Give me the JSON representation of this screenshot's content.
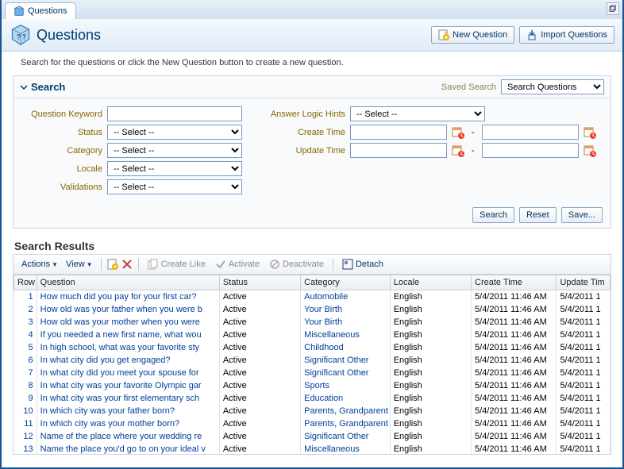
{
  "tab": {
    "label": "Questions"
  },
  "header": {
    "title": "Questions",
    "new_question": "New Question",
    "import_questions": "Import Questions"
  },
  "instruction": "Search for the questions or click the New Question button to create a new question.",
  "search": {
    "title": "Search",
    "saved_label": "Saved Search",
    "saved_value": "Search Questions",
    "fields": {
      "keyword": "Question Keyword",
      "status": "Status",
      "category": "Category",
      "locale": "Locale",
      "validations": "Validations",
      "answer_logic": "Answer Logic Hints",
      "create_time": "Create Time",
      "update_time": "Update Time"
    },
    "select_placeholder": "-- Select --",
    "buttons": {
      "search": "Search",
      "reset": "Reset",
      "save": "Save..."
    }
  },
  "results": {
    "title": "Search Results",
    "toolbar": {
      "actions": "Actions",
      "view": "View",
      "create_like": "Create Like",
      "activate": "Activate",
      "deactivate": "Deactivate",
      "detach": "Detach"
    },
    "columns": [
      "Row",
      "Question",
      "Status",
      "Category",
      "Locale",
      "Create Time",
      "Update Tim"
    ],
    "rows": [
      {
        "n": 1,
        "q": "How much did you pay for your first car?",
        "s": "Active",
        "c": "Automobile",
        "l": "English",
        "ct": "5/4/2011 11:46 AM",
        "ut": "5/4/2011 1"
      },
      {
        "n": 2,
        "q": "How old was your father when you were b",
        "s": "Active",
        "c": "Your Birth",
        "l": "English",
        "ct": "5/4/2011 11:46 AM",
        "ut": "5/4/2011 1"
      },
      {
        "n": 3,
        "q": "How old was your mother when you were",
        "s": "Active",
        "c": "Your Birth",
        "l": "English",
        "ct": "5/4/2011 11:46 AM",
        "ut": "5/4/2011 1"
      },
      {
        "n": 4,
        "q": "If you needed a new first name, what wou",
        "s": "Active",
        "c": "Miscellaneous",
        "l": "English",
        "ct": "5/4/2011 11:46 AM",
        "ut": "5/4/2011 1"
      },
      {
        "n": 5,
        "q": "In high school, what was your favorite sty",
        "s": "Active",
        "c": "Childhood",
        "l": "English",
        "ct": "5/4/2011 11:46 AM",
        "ut": "5/4/2011 1"
      },
      {
        "n": 6,
        "q": "In what city did you get engaged?",
        "s": "Active",
        "c": "Significant Other",
        "l": "English",
        "ct": "5/4/2011 11:46 AM",
        "ut": "5/4/2011 1"
      },
      {
        "n": 7,
        "q": "In what city did you meet your spouse for",
        "s": "Active",
        "c": "Significant Other",
        "l": "English",
        "ct": "5/4/2011 11:46 AM",
        "ut": "5/4/2011 1"
      },
      {
        "n": 8,
        "q": "In what city was your favorite Olympic gar",
        "s": "Active",
        "c": "Sports",
        "l": "English",
        "ct": "5/4/2011 11:46 AM",
        "ut": "5/4/2011 1"
      },
      {
        "n": 9,
        "q": "In what city was your first elementary sch",
        "s": "Active",
        "c": "Education",
        "l": "English",
        "ct": "5/4/2011 11:46 AM",
        "ut": "5/4/2011 1"
      },
      {
        "n": 10,
        "q": "In which city was your father born?",
        "s": "Active",
        "c": "Parents, Grandparent",
        "l": "English",
        "ct": "5/4/2011 11:46 AM",
        "ut": "5/4/2011 1"
      },
      {
        "n": 11,
        "q": "In which city was your mother born?",
        "s": "Active",
        "c": "Parents, Grandparent",
        "l": "English",
        "ct": "5/4/2011 11:46 AM",
        "ut": "5/4/2011 1"
      },
      {
        "n": 12,
        "q": "Name of the place where your wedding re",
        "s": "Active",
        "c": "Significant Other",
        "l": "English",
        "ct": "5/4/2011 11:46 AM",
        "ut": "5/4/2011 1"
      },
      {
        "n": 13,
        "q": "Name the place you'd go to on your ideal v",
        "s": "Active",
        "c": "Miscellaneous",
        "l": "English",
        "ct": "5/4/2011 11:46 AM",
        "ut": "5/4/2011 1"
      }
    ]
  }
}
